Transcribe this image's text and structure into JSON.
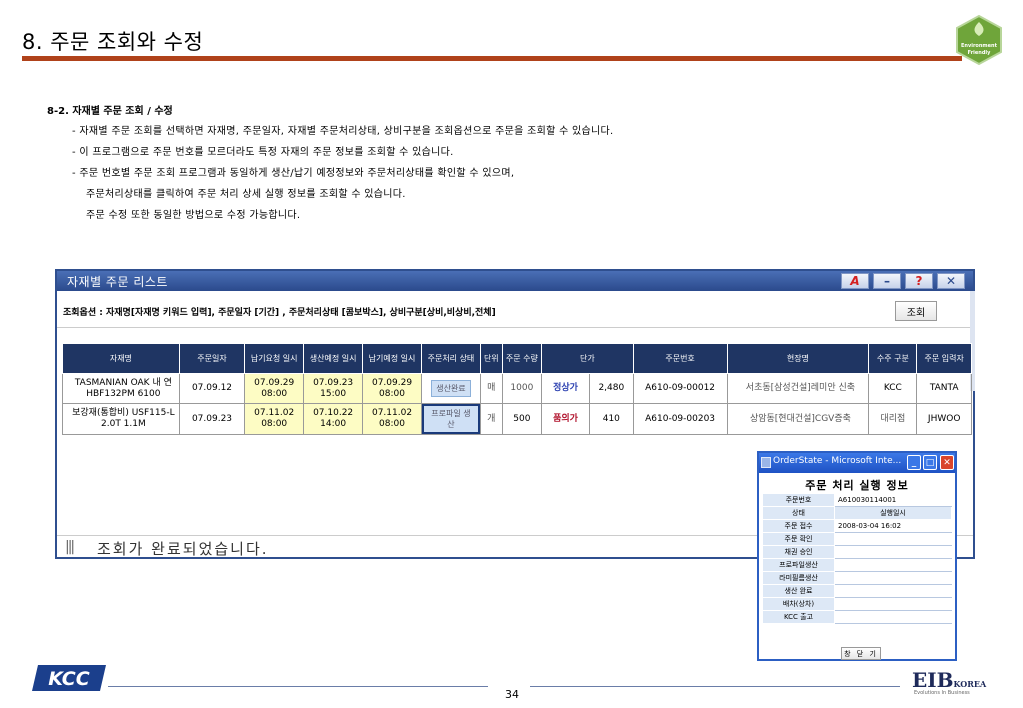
{
  "slide": {
    "title": "8. 주문 조회와 수정",
    "badge_text": "Environment Friendly",
    "section_heading": "8-2. 자재별 주문 조회 / 수정",
    "lines": [
      "- 자재별 주문 조회를 선택하면 자재명, 주문일자, 자재별 주문처리상태, 상비구분을 조회옵션으로 주문을 조회할 수 있습니다.",
      "- 이 프로그램으로 주문 번호를 모르더라도 특정 자재의 주문 정보를 조회할 수 있습니다.",
      "- 주문 번호별 주문 조회 프로그램과 동일하게 생산/납기 예정정보와 주문처리상태를 확인할 수 있으며,",
      "주문처리상태를 클릭하여 주문 처리 상세 실행 정보를 조회할 수 있습니다.",
      "주문 수정 또한 동일한 방법으로 수정 가능합니다."
    ],
    "page_number": "34"
  },
  "window": {
    "title": "자재별 주문 리스트",
    "toolbar_icons": [
      "acrobat-icon",
      "minimize-icon",
      "help-icon",
      "close-icon"
    ],
    "options_text": "조회옵션 : 자재명[자재명 키워드 입력], 주문일자 [기간] , 주문처리상태 [콤보박스], 상비구분[상비,비상비,전체]",
    "query_button": "조회",
    "columns": [
      "자재명",
      "주문일자",
      "납기요청 일시",
      "생산예정 일시",
      "납기예정 일시",
      "주문처리 상태",
      "단위",
      "주문 수량",
      "단가",
      "",
      "주문번호",
      "현장명",
      "수주 구분",
      "주문 입력자"
    ],
    "rows": [
      {
        "material": "TASMANIAN OAK 내 연 HBF132PM 6100",
        "order_date": "07.09.12",
        "request_dt": "07.09.29 08:00",
        "prod_dt": "07.09.23 15:00",
        "delivery_dt": "07.09.29 08:00",
        "state": "생산완료",
        "unit": "매",
        "qty": "1000",
        "price_type": "정상가",
        "price": "2,480",
        "order_no": "A610-09-00012",
        "site": "서초동[삼성건설]레미안 신축",
        "type": "KCC",
        "user": "TANTA"
      },
      {
        "material": "보강재(통합비) USF115-L 2.0T 1.1M",
        "order_date": "07.09.23",
        "request_dt": "07.11.02 08:00",
        "prod_dt": "07.10.22 14:00",
        "delivery_dt": "07.11.02 08:00",
        "state": "프로파일 생산",
        "unit": "개",
        "qty": "500",
        "price_type": "품의가",
        "price": "410",
        "order_no": "A610-09-00203",
        "site": "상암동[현대건설]CGV증축",
        "type": "대리점",
        "user": "JHWOO"
      }
    ],
    "status_text": "조회가 완료되었습니다."
  },
  "popup": {
    "title": "OrderState - Microsoft Inte...",
    "heading": "주문 처리 실행 정보",
    "order_no_label": "주문번호",
    "order_no": "A610030114001",
    "col_state": "상태",
    "col_time": "실행일시",
    "steps": [
      {
        "label": "주문 접수",
        "time": "2008-03-04 16:02"
      },
      {
        "label": "주문 확인",
        "time": ""
      },
      {
        "label": "채권 승인",
        "time": ""
      },
      {
        "label": "프로파일생산",
        "time": ""
      },
      {
        "label": "라미필름생산",
        "time": ""
      },
      {
        "label": "생산 완료",
        "time": ""
      },
      {
        "label": "배차(상차)",
        "time": ""
      },
      {
        "label": "KCC 출고",
        "time": ""
      }
    ],
    "close_label": "창 닫 기"
  },
  "footer": {
    "kcc_logo": "KCC",
    "eib_logo": "EIB",
    "eib_suffix": "KOREA",
    "eib_tag": "Evolutions In Business"
  },
  "colors": {
    "title_rule": "#b0421a",
    "table_header": "#1f3563",
    "window_border": "#2f4f8f",
    "popup_bar": "#1e52c4"
  }
}
